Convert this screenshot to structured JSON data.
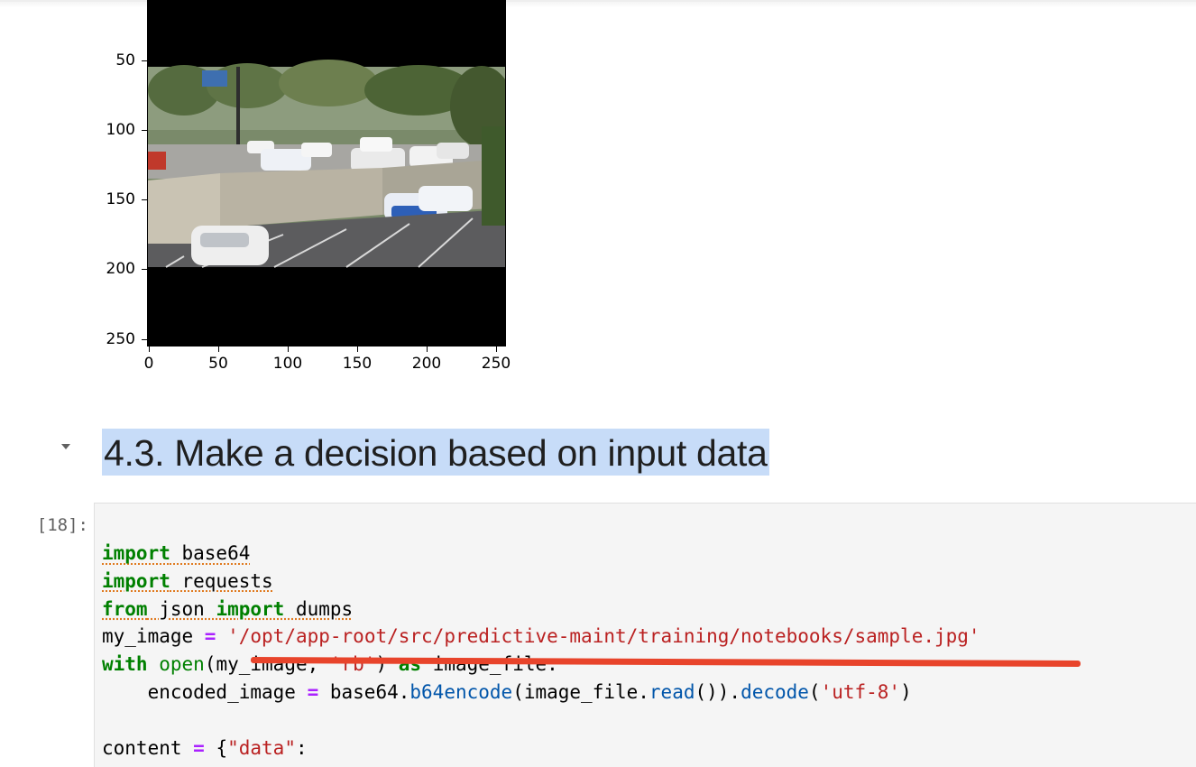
{
  "plot": {
    "y_ticks": [
      "50",
      "100",
      "150",
      "200",
      "250"
    ],
    "x_ticks": [
      "0",
      "50",
      "100",
      "150",
      "200",
      "250"
    ]
  },
  "heading": {
    "text": "4.3. Make a decision based on input data"
  },
  "cell": {
    "prompt": "[18]:",
    "lines": [
      [
        {
          "t": "import",
          "c": "kw squig"
        },
        {
          "t": " base64",
          "c": "squig"
        }
      ],
      [
        {
          "t": "import",
          "c": "kw squig"
        },
        {
          "t": " requests",
          "c": "squig"
        }
      ],
      [
        {
          "t": "from",
          "c": "kw squig"
        },
        {
          "t": " json ",
          "c": "squig"
        },
        {
          "t": "import",
          "c": "kw squig"
        },
        {
          "t": " dumps",
          "c": "squig"
        }
      ],
      [
        {
          "t": "my_image ",
          "c": ""
        },
        {
          "t": "=",
          "c": "op"
        },
        {
          "t": " ",
          "c": ""
        },
        {
          "t": "'/opt/app-root/src/predictive-maint/training/notebooks/sample.jpg'",
          "c": "str"
        }
      ],
      [
        {
          "t": "with",
          "c": "kw"
        },
        {
          "t": " ",
          "c": ""
        },
        {
          "t": "open",
          "c": "bi"
        },
        {
          "t": "(my_image, ",
          "c": ""
        },
        {
          "t": "'rb'",
          "c": "str"
        },
        {
          "t": ") ",
          "c": ""
        },
        {
          "t": "as",
          "c": "kw"
        },
        {
          "t": " image_file:",
          "c": ""
        }
      ],
      [
        {
          "t": "    encoded_image ",
          "c": ""
        },
        {
          "t": "=",
          "c": "op"
        },
        {
          "t": " base64.",
          "c": ""
        },
        {
          "t": "b64encode",
          "c": "fn"
        },
        {
          "t": "(image_file.",
          "c": ""
        },
        {
          "t": "read",
          "c": "fn"
        },
        {
          "t": "()).",
          "c": ""
        },
        {
          "t": "decode",
          "c": "fn"
        },
        {
          "t": "(",
          "c": ""
        },
        {
          "t": "'utf-8'",
          "c": "str"
        },
        {
          "t": ")",
          "c": ""
        }
      ],
      [
        {
          "t": "",
          "c": ""
        }
      ],
      [
        {
          "t": "content ",
          "c": ""
        },
        {
          "t": "=",
          "c": "op"
        },
        {
          "t": " {",
          "c": ""
        },
        {
          "t": "\"data\"",
          "c": "str"
        },
        {
          "t": ":",
          "c": ""
        }
      ]
    ]
  },
  "colors": {
    "highlight": "#c7dcf8",
    "annotation": "#e8442b",
    "keyword": "#008000",
    "string": "#ba2121"
  }
}
